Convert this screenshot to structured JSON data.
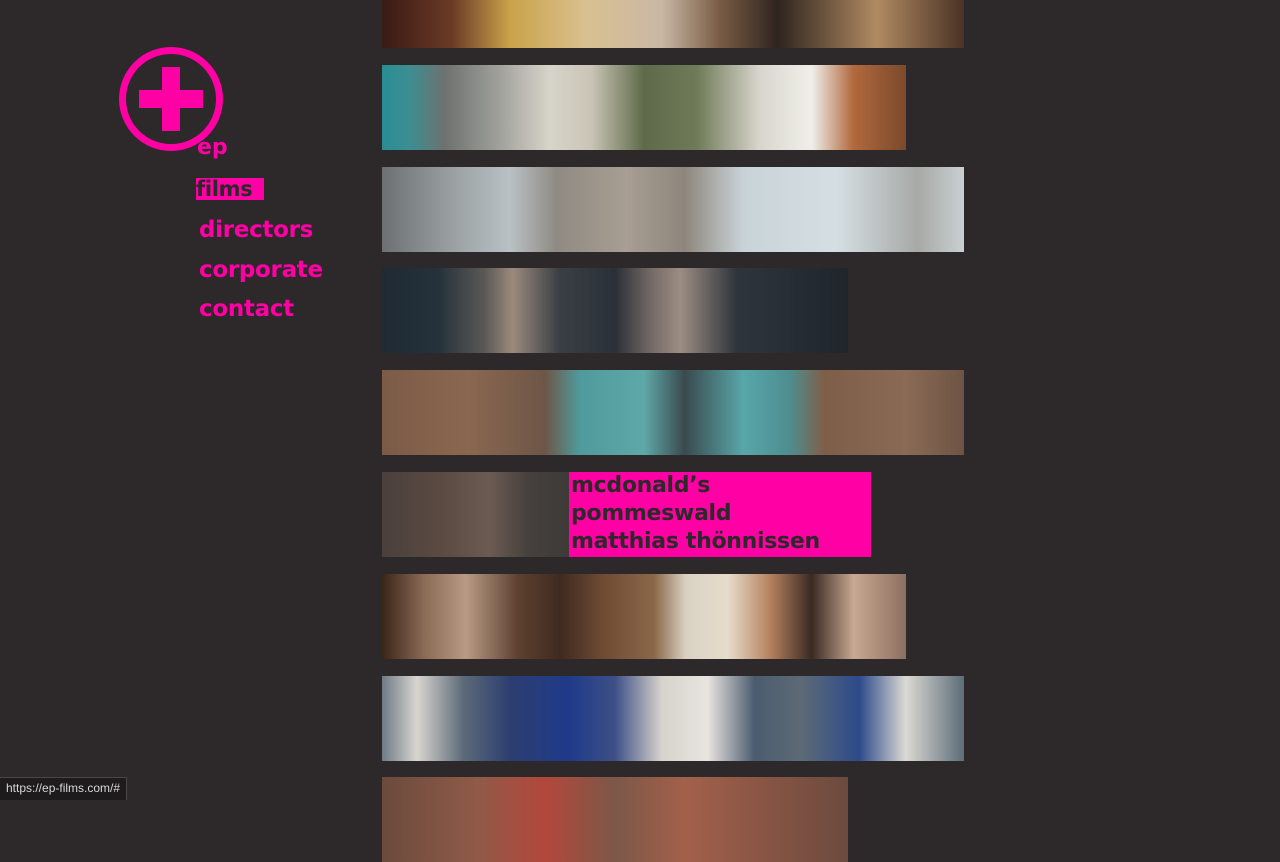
{
  "logo": {
    "text": "ep",
    "color": "#ff00a4"
  },
  "nav": {
    "items": [
      {
        "label": "films",
        "active": true
      },
      {
        "label": "directors",
        "active": false
      },
      {
        "label": "corporate",
        "active": false
      },
      {
        "label": "contact",
        "active": false
      }
    ]
  },
  "tiles": [
    {
      "name": "film-tile-1"
    },
    {
      "name": "film-tile-2"
    },
    {
      "name": "film-tile-3"
    },
    {
      "name": "film-tile-4"
    },
    {
      "name": "film-tile-5"
    },
    {
      "name": "film-tile-6",
      "hover": {
        "line1": "mcdonald’s",
        "line2": "pommeswald",
        "line3": "matthias thönnissen"
      }
    },
    {
      "name": "film-tile-7"
    },
    {
      "name": "film-tile-8"
    },
    {
      "name": "film-tile-9"
    }
  ],
  "status_bar": {
    "url": "https://ep-films.com/#"
  }
}
